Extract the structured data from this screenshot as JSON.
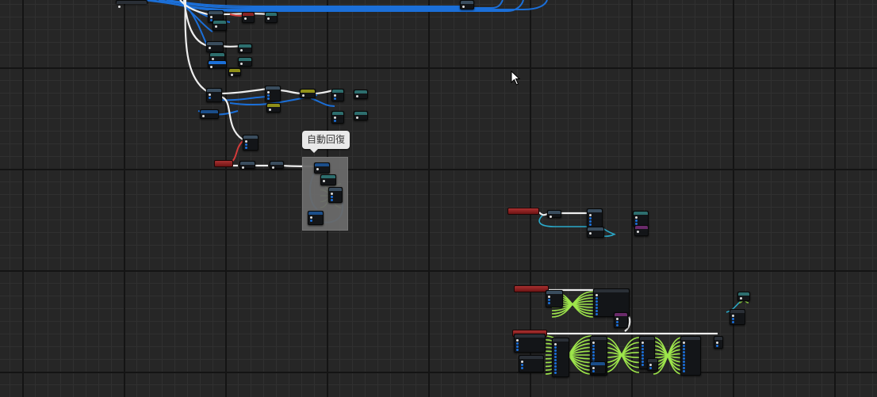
{
  "window": {
    "kind": "visual-script-graph-editor"
  },
  "comment": {
    "text": "自動回復"
  },
  "icons": {
    "cursor": "mouse-pointer-icon"
  },
  "colors": {
    "background": "#262626",
    "grid_minor": "#303030",
    "grid_major": "#141414",
    "exec_wire": "#f0f0f0",
    "object_wire": "#1b6fd8",
    "float_wire": "#9ee64b",
    "bool_wire": "#d13a3a",
    "struct_wire": "#2a8fd6",
    "event_header": "#a52b2b",
    "comment_box": "#6a6a6a"
  }
}
